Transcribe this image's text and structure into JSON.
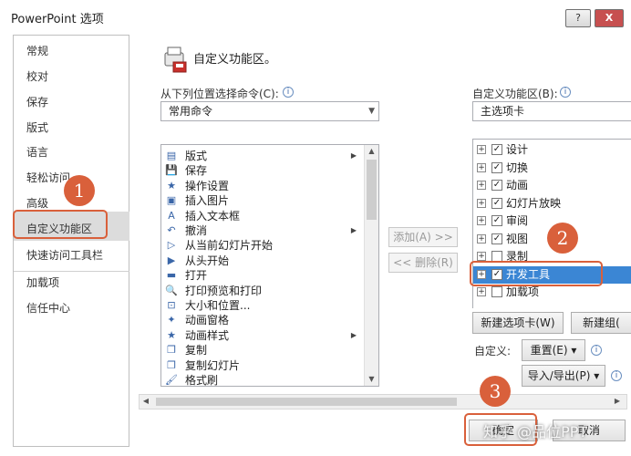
{
  "window": {
    "title": "PowerPoint 选项",
    "help": "?",
    "close": "X"
  },
  "sidebar": {
    "items": [
      "常规",
      "校对",
      "保存",
      "版式",
      "语言",
      "轻松访问",
      "高级",
      "自定义功能区",
      "快速访问工具栏",
      "加载项",
      "信任中心"
    ]
  },
  "header": {
    "title": "自定义功能区。"
  },
  "left": {
    "label": "从下列位置选择命令(C):",
    "dropdown": "常用命令",
    "commands": [
      {
        "label": "版式",
        "icon": "layout-icon",
        "glyph": "▤",
        "submenu": true
      },
      {
        "label": "保存",
        "icon": "save-icon",
        "glyph": "💾",
        "submenu": false
      },
      {
        "label": "操作设置",
        "icon": "action-settings-icon",
        "glyph": "★",
        "submenu": false
      },
      {
        "label": "插入图片",
        "icon": "insert-picture-icon",
        "glyph": "▣",
        "submenu": false
      },
      {
        "label": "插入文本框",
        "icon": "textbox-icon",
        "glyph": "A",
        "submenu": false
      },
      {
        "label": "撤消",
        "icon": "undo-icon",
        "glyph": "↶",
        "submenu": true
      },
      {
        "label": "从当前幻灯片开始",
        "icon": "start-current-slide-icon",
        "glyph": "▷",
        "submenu": false
      },
      {
        "label": "从头开始",
        "icon": "start-beginning-icon",
        "glyph": "▶",
        "submenu": false
      },
      {
        "label": "打开",
        "icon": "open-folder-icon",
        "glyph": "▬",
        "submenu": false
      },
      {
        "label": "打印预览和打印",
        "icon": "print-preview-icon",
        "glyph": "🔍",
        "submenu": false
      },
      {
        "label": "大小和位置...",
        "icon": "size-position-icon",
        "glyph": "⊡",
        "submenu": false
      },
      {
        "label": "动画窗格",
        "icon": "animation-pane-icon",
        "glyph": "✦",
        "submenu": false
      },
      {
        "label": "动画样式",
        "icon": "animation-styles-icon",
        "glyph": "★",
        "submenu": true
      },
      {
        "label": "复制",
        "icon": "copy-icon",
        "glyph": "❐",
        "submenu": false
      },
      {
        "label": "复制幻灯片",
        "icon": "duplicate-slide-icon",
        "glyph": "❐",
        "submenu": false
      },
      {
        "label": "格式刷",
        "icon": "format-painter-icon",
        "glyph": "🖌",
        "submenu": false
      }
    ]
  },
  "middle": {
    "add": "添加(A) >>",
    "remove": "<< 删除(R)"
  },
  "right": {
    "label": "自定义功能区(B):",
    "dropdown": "主选项卡",
    "tabs": [
      {
        "label": "设计",
        "checked": true
      },
      {
        "label": "切换",
        "checked": true
      },
      {
        "label": "动画",
        "checked": true
      },
      {
        "label": "幻灯片放映",
        "checked": true
      },
      {
        "label": "审阅",
        "checked": true
      },
      {
        "label": "视图",
        "checked": true
      },
      {
        "label": "录制",
        "checked": false
      },
      {
        "label": "开发工具",
        "checked": true,
        "selected": true
      },
      {
        "label": "加载项",
        "checked": false
      }
    ],
    "new_tab": "新建选项卡(W)",
    "new_group": "新建组(",
    "customize_label": "自定义:",
    "reset": "重置(E) ▾",
    "import_export": "导入/导出(P) ▾"
  },
  "footer": {
    "ok": "确定",
    "cancel": "取消"
  },
  "callouts": [
    "1",
    "2",
    "3"
  ],
  "watermark": "知乎 @品位PPT"
}
